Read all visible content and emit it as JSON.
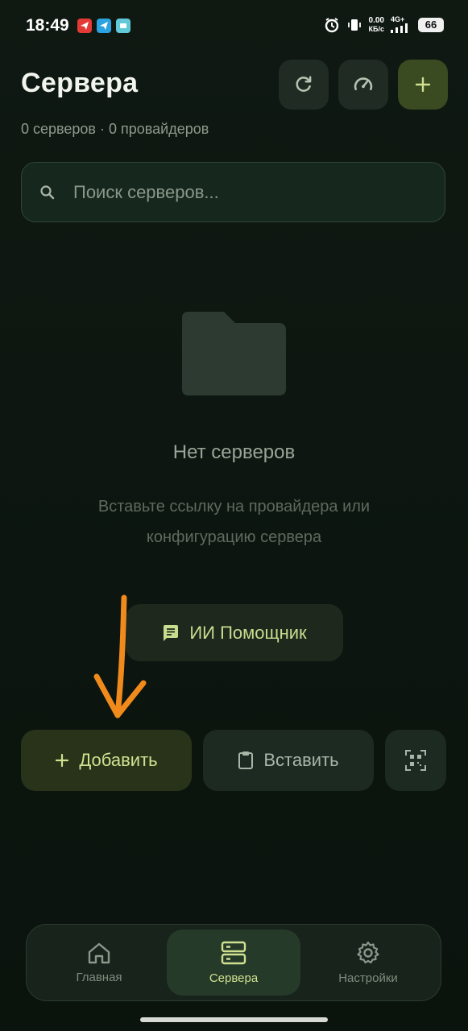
{
  "status_bar": {
    "time": "18:49",
    "speed_value": "0.00",
    "speed_unit": "КБ/с",
    "network": "4G+",
    "battery": "66"
  },
  "header": {
    "title": "Сервера",
    "subtitle": "0 серверов · 0 провайдеров",
    "refresh_icon": "refresh-icon",
    "speed_icon": "speedometer-icon",
    "add_icon": "plus-icon"
  },
  "search": {
    "placeholder": "Поиск серверов..."
  },
  "empty_state": {
    "title": "Нет серверов",
    "description": "Вставьте ссылку на провайдера или конфигурацию сервера"
  },
  "ai_button": {
    "label": "ИИ Помощник"
  },
  "actions": {
    "add_label": "Добавить",
    "paste_label": "Вставить"
  },
  "bottom_nav": {
    "items": [
      {
        "label": "Главная",
        "icon": "home-icon"
      },
      {
        "label": "Сервера",
        "icon": "server-icon"
      },
      {
        "label": "Настройки",
        "icon": "gear-icon"
      }
    ],
    "active_index": 1
  },
  "colors": {
    "accent": "#cfe18f",
    "background": "#0d1610",
    "arrow": "#f08a1c"
  }
}
